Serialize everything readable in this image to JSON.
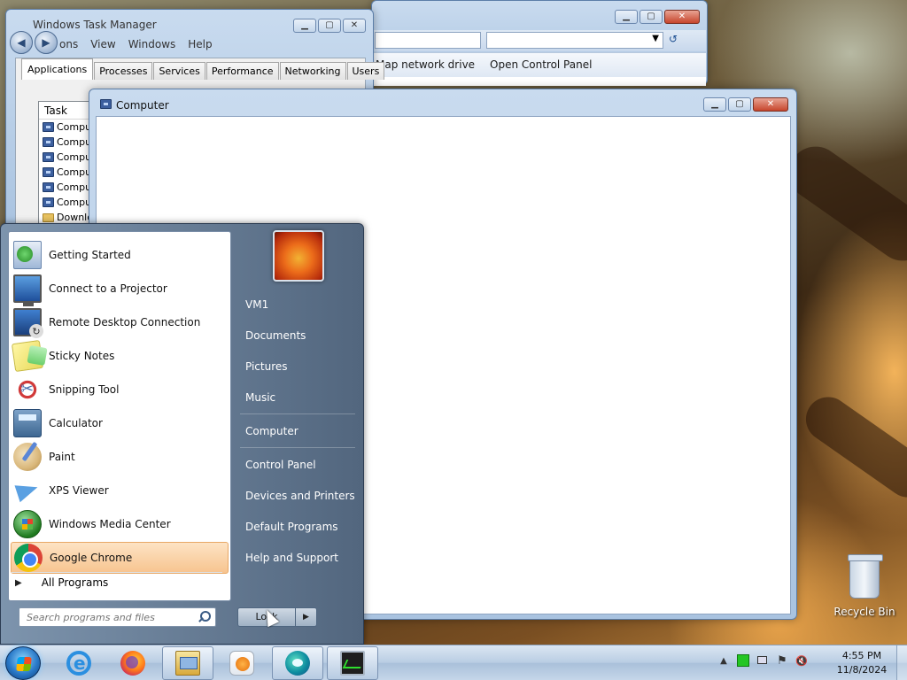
{
  "explorer_back": {
    "commands": [
      "Map network drive",
      "Open Control Panel"
    ]
  },
  "task_manager": {
    "title": "Windows Task Manager",
    "menu": [
      "ons",
      "View",
      "Windows",
      "Help"
    ],
    "tabs": [
      "Applications",
      "Processes",
      "Services",
      "Performance",
      "Networking",
      "Users"
    ],
    "column_task": "Task",
    "rows": [
      "Comput",
      "Comput",
      "Comput",
      "Comput",
      "Comput",
      "Comput",
      "Downlo"
    ]
  },
  "computer_window": {
    "title": "Computer"
  },
  "start_menu": {
    "programs": [
      {
        "label": "Getting Started",
        "icon": "getting-started-icon"
      },
      {
        "label": "Connect to a Projector",
        "icon": "projector-icon"
      },
      {
        "label": "Remote Desktop Connection",
        "icon": "remote-desktop-icon"
      },
      {
        "label": "Sticky Notes",
        "icon": "sticky-notes-icon"
      },
      {
        "label": "Snipping Tool",
        "icon": "snipping-tool-icon"
      },
      {
        "label": "Calculator",
        "icon": "calculator-icon"
      },
      {
        "label": "Paint",
        "icon": "paint-icon"
      },
      {
        "label": "XPS Viewer",
        "icon": "xps-viewer-icon"
      },
      {
        "label": "Windows Media Center",
        "icon": "media-center-icon"
      },
      {
        "label": "Google Chrome",
        "icon": "chrome-icon"
      }
    ],
    "highlighted_program": "Google Chrome",
    "all_programs": "All Programs",
    "search_placeholder": "Search programs and files",
    "right_links": [
      "VM1",
      "Documents",
      "Pictures",
      "Music",
      "Computer",
      "Control Panel",
      "Devices and Printers",
      "Default Programs",
      "Help and Support"
    ],
    "shutdown_label": "Lock"
  },
  "desktop": {
    "recycle_bin": "Recycle Bin"
  },
  "taskbar": {
    "pinned": [
      "internet-explorer-icon",
      "firefox-icon",
      "windows-explorer-icon",
      "media-player-icon",
      "edge-icon",
      "task-manager-icon"
    ],
    "clock_time": "4:55 PM",
    "clock_date": "11/8/2024"
  },
  "colors": {
    "highlight": "#f7c48f",
    "start_menu_right": "#52667e",
    "close_button": "#c7452c"
  }
}
